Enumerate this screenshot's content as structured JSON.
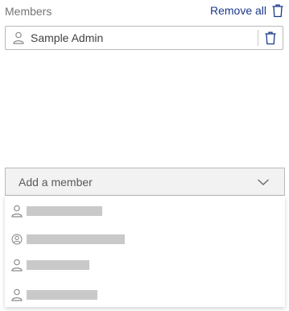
{
  "section": {
    "title": "Members",
    "remove_all_label": "Remove all"
  },
  "members": [
    {
      "name": "Sample Admin",
      "icon": "user-icon"
    }
  ],
  "add_member": {
    "placeholder": "Add a member",
    "icon": "chevron-down-icon"
  },
  "dropdown": {
    "options": [
      {
        "icon": "user-icon",
        "name_redacted": true
      },
      {
        "icon": "user-circle-icon",
        "name_redacted": true
      },
      {
        "icon": "user-icon",
        "name_redacted": true
      },
      {
        "icon": "user-icon",
        "name_redacted": true
      }
    ]
  },
  "colors": {
    "link": "#1b3a8c",
    "border": "#b9b9b9",
    "field_background": "#f2f2f2",
    "redaction": "#c9c9c9"
  }
}
